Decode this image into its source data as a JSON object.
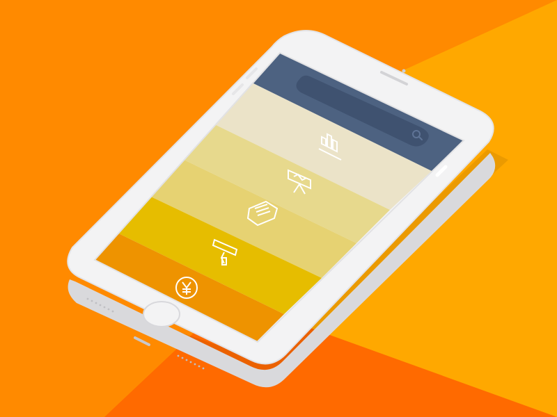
{
  "colors": {
    "background_main": "#ff8a00",
    "background_light": "#ffa800",
    "background_dark": "#ff6a00",
    "phone_body": "#f3f3f4",
    "phone_screen_frame": "#e2e2e4",
    "header_bar": "#4d6281",
    "search_pill": "#3f5270",
    "tiles": [
      "#ebe3c8",
      "#e7d98d",
      "#e6d272",
      "#e6bd00",
      "#ee9300"
    ],
    "icon_stroke": "#ffffff"
  },
  "header": {
    "search_icon": "search-icon"
  },
  "menu": {
    "items": [
      {
        "icon": "bar-chart-icon"
      },
      {
        "icon": "presentation-board-icon"
      },
      {
        "icon": "inbox-tray-icon"
      },
      {
        "icon": "paint-roller-icon"
      },
      {
        "icon": "yen-coin-icon"
      }
    ]
  }
}
